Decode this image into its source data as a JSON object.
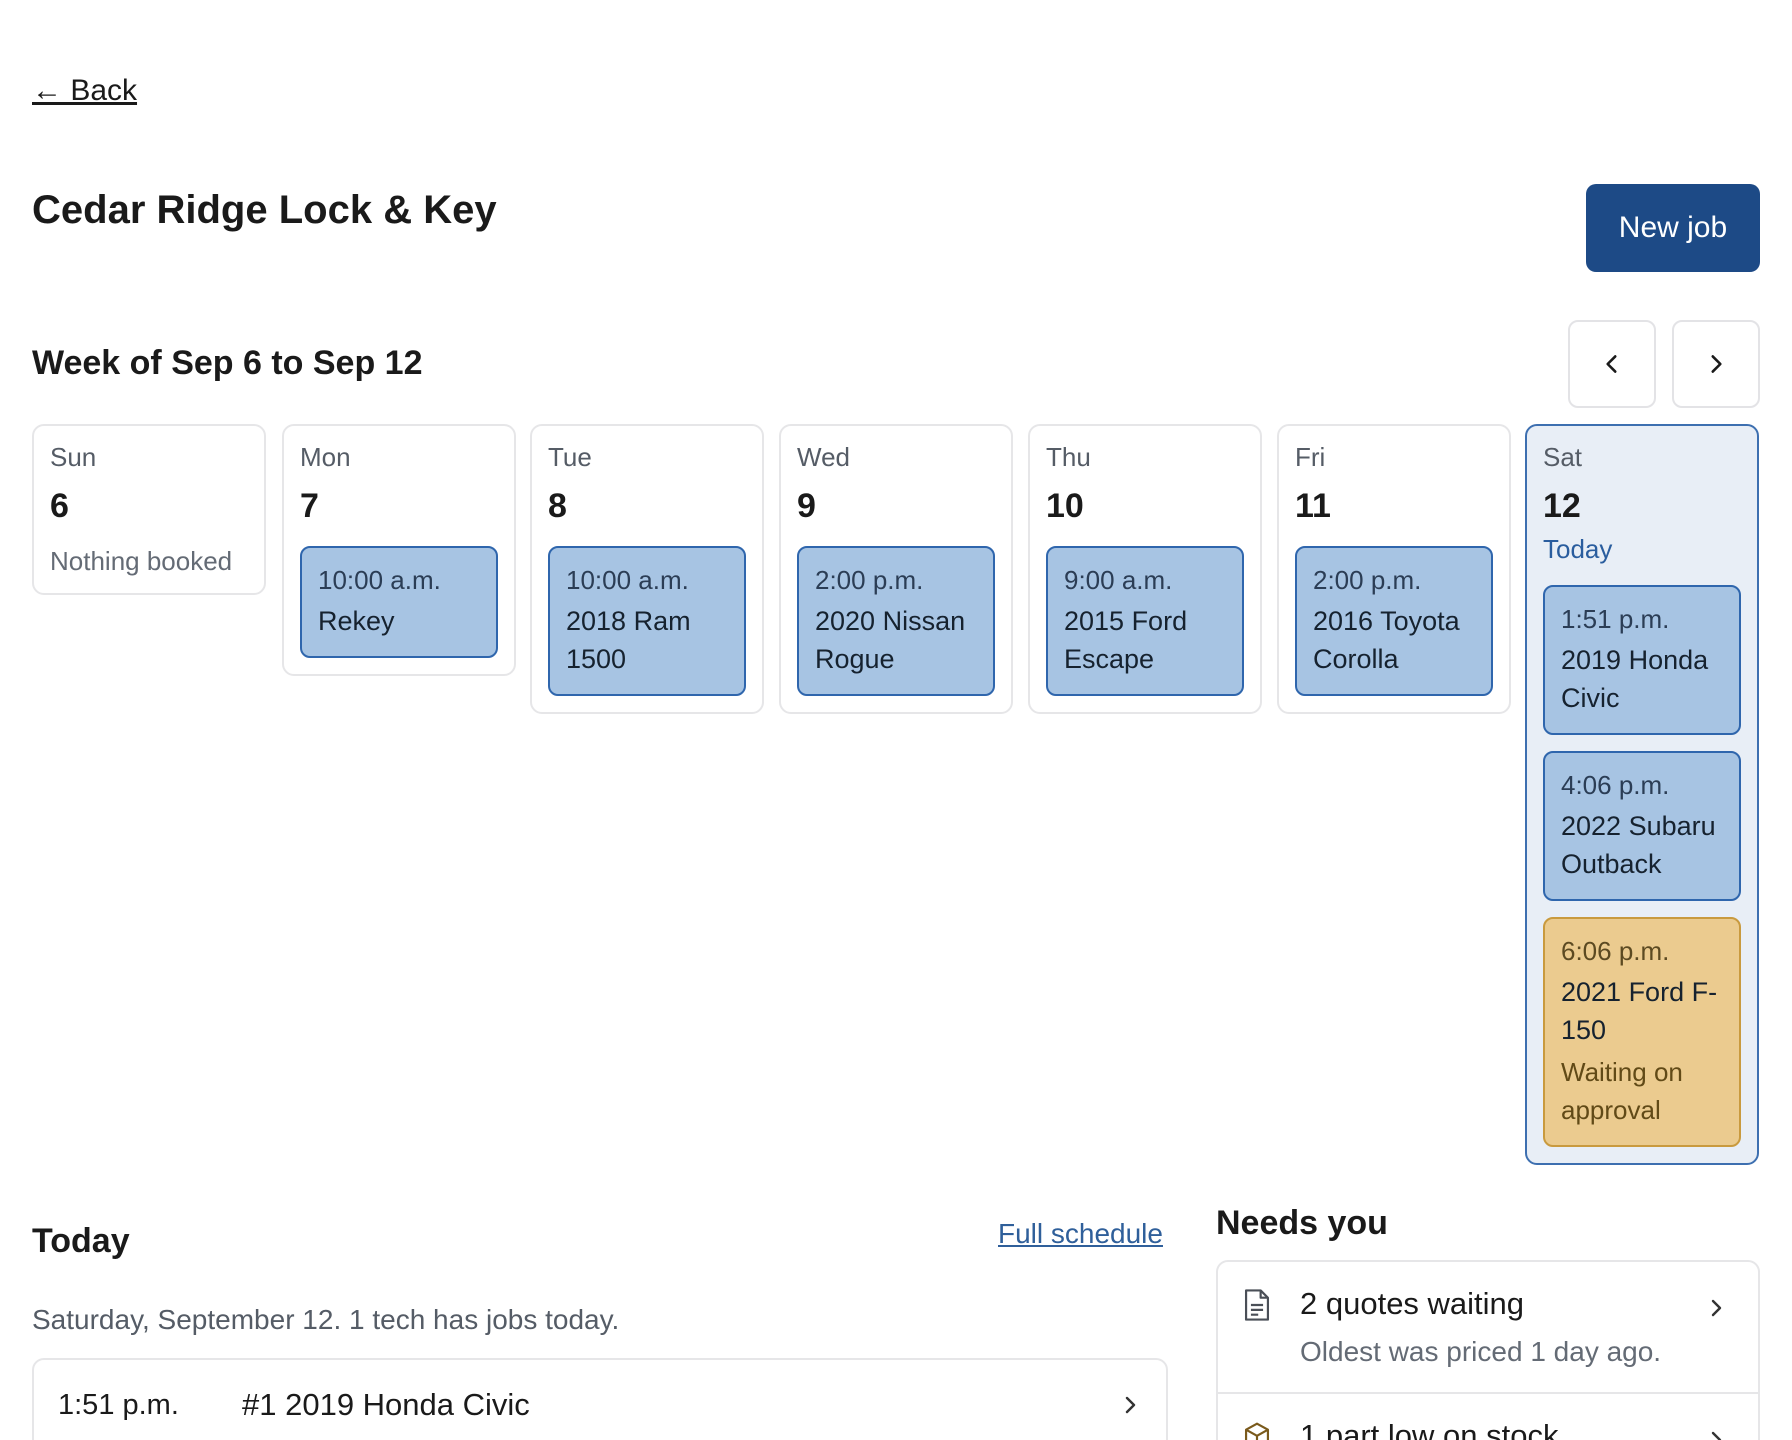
{
  "nav": {
    "back_label": "← Back"
  },
  "header": {
    "title": "Cedar Ridge Lock & Key",
    "new_job_label": "New job"
  },
  "week": {
    "title": "Week of Sep 6 to Sep 12",
    "prev_icon": "chevron-left-icon",
    "next_icon": "chevron-right-icon",
    "days": [
      {
        "dow": "Sun",
        "num": "6",
        "empty": "Nothing booked",
        "jobs": []
      },
      {
        "dow": "Mon",
        "num": "7",
        "jobs": [
          {
            "time": "10:00 a.m.",
            "label": "Rekey"
          }
        ]
      },
      {
        "dow": "Tue",
        "num": "8",
        "jobs": [
          {
            "time": "10:00 a.m.",
            "label": "2018 Ram 1500"
          }
        ]
      },
      {
        "dow": "Wed",
        "num": "9",
        "jobs": [
          {
            "time": "2:00 p.m.",
            "label": "2020 Nissan Rogue"
          }
        ]
      },
      {
        "dow": "Thu",
        "num": "10",
        "jobs": [
          {
            "time": "9:00 a.m.",
            "label": "2015 Ford Escape"
          }
        ]
      },
      {
        "dow": "Fri",
        "num": "11",
        "jobs": [
          {
            "time": "2:00 p.m.",
            "label": "2016 Toyota Corolla"
          }
        ]
      },
      {
        "dow": "Sat",
        "num": "12",
        "today_label": "Today",
        "jobs": [
          {
            "time": "1:51 p.m.",
            "label": "2019 Honda Civic"
          },
          {
            "time": "4:06 p.m.",
            "label": "2022 Subaru Outback"
          },
          {
            "time": "6:06 p.m.",
            "label": "2021 Ford F-150",
            "note": "Waiting on approval"
          }
        ]
      }
    ]
  },
  "today": {
    "title": "Today",
    "full_schedule_label": "Full schedule",
    "subtitle": "Saturday, September 12. 1 tech has jobs today.",
    "rows": [
      {
        "time": "1:51 p.m.",
        "label": "#1 2019 Honda Civic"
      }
    ]
  },
  "needs": {
    "title": "Needs you",
    "items": [
      {
        "icon": "document-icon",
        "title": "2 quotes waiting",
        "desc": "Oldest was priced 1 day ago."
      },
      {
        "icon": "box-icon",
        "title": "1 part low on stock",
        "desc": ""
      }
    ]
  },
  "colors": {
    "primary": "#1d4a86",
    "job_fill": "#a7c4e3",
    "job_border": "#2f66ad",
    "pending_fill": "#ebcb8f",
    "today_column": "#e8eef6"
  }
}
